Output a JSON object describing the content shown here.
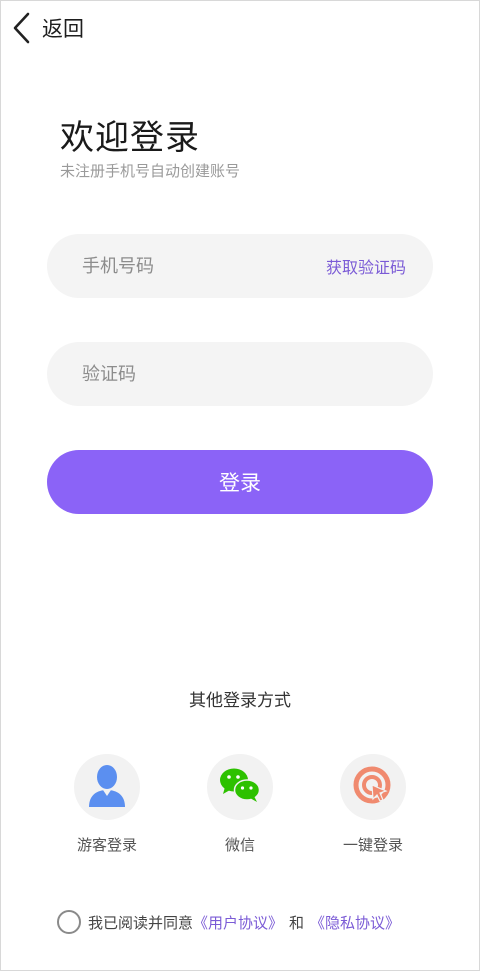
{
  "header": {
    "back_label": "返回",
    "back_icon": "chevron-left-icon"
  },
  "intro": {
    "title": "欢迎登录",
    "subtitle": "未注册手机号自动创建账号"
  },
  "form": {
    "phone_placeholder": "手机号码",
    "phone_value": "",
    "get_code_label": "获取验证码",
    "code_placeholder": "验证码",
    "code_value": "",
    "login_label": "登录"
  },
  "other": {
    "title": "其他登录方式",
    "methods": [
      {
        "label": "游客登录",
        "icon": "guest-user-icon"
      },
      {
        "label": "微信",
        "icon": "wechat-icon"
      },
      {
        "label": "一键登录",
        "icon": "one-click-login-icon"
      }
    ]
  },
  "agreement": {
    "checked": false,
    "prefix": "我已阅读并同意",
    "user_agreement": "《用户协议》",
    "and": "和",
    "privacy_policy": "《隐私协议》"
  },
  "colors": {
    "accent": "#8b63f7",
    "link": "#7b5bd6",
    "input_bg": "#f4f4f4",
    "wechat_green": "#2dc100",
    "guest_blue": "#5b8ff0",
    "one_click_orange": "#f08a6f"
  }
}
